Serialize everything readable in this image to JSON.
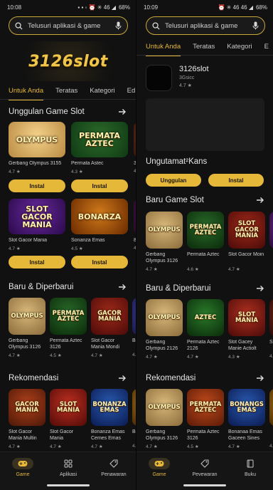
{
  "left": {
    "status": {
      "time": "10:08",
      "battery": "68%",
      "icons": "▪ ▪ ◦  ⏰ ✳ 46 ◢"
    },
    "search": {
      "placeholder": "Telusuri aplikasi & game"
    },
    "banner": {
      "text": "3126slot"
    },
    "tabs": [
      "Untuk Anda",
      "Teratas",
      "Kategori",
      "Ed"
    ],
    "sections": [
      {
        "title": "Unggulan Game Slot"
      },
      {
        "title": "Baru & Diperbarui"
      },
      {
        "title": "Rekomendasi"
      }
    ],
    "featured_row1": [
      {
        "name": "Gerbang Olympus 3155",
        "rating": "4.7 ★",
        "thumb_text": "OLYMPUS",
        "colors": [
          "#f4d28a",
          "#b98a43"
        ]
      },
      {
        "name": "Permata Astec",
        "rating": "4.3 ★",
        "thumb_text": "PERMATA AZTEC",
        "colors": [
          "#2d6a2b",
          "#0f3a14"
        ]
      },
      {
        "name": "3t",
        "rating": "4.",
        "thumb_text": "",
        "colors": [
          "#7a3b1a",
          "#3a1808"
        ]
      }
    ],
    "featured_row1_buttons": [
      "Instal",
      "Instal"
    ],
    "featured_row2": [
      {
        "name": "Slot Gacor Mania",
        "rating": "4.7 ★",
        "thumb_text": "SLOT GACOR MANIA",
        "colors": [
          "#6a2aa0",
          "#2a0a4a"
        ]
      },
      {
        "name": "Sonanza Emas",
        "rating": "4.5 ★",
        "thumb_text": "BONARZA",
        "colors": [
          "#d07a1a",
          "#6a2a00"
        ]
      },
      {
        "name": "8t",
        "rating": "4.",
        "thumb_text": "",
        "colors": [
          "#5a1a5a",
          "#2a082a"
        ]
      }
    ],
    "featured_row2_buttons": [
      "Instal",
      "Instal"
    ],
    "new_row": [
      {
        "name": "Gerbang Olympus 3126",
        "rating": "4.7 ★",
        "thumb_text": "OLYMPUS",
        "colors": [
          "#d9b97a",
          "#8a6a3a"
        ]
      },
      {
        "name": "Permata Aztec 3126",
        "rating": "4.5 ★",
        "thumb_text": "PERMATA AZTEC",
        "colors": [
          "#2a6a2a",
          "#0a2a0a"
        ]
      },
      {
        "name": "Slot Gacor Mania Mondi",
        "rating": "4.7 ★",
        "thumb_text": "GACOR MANIA",
        "colors": [
          "#a02a1a",
          "#4a0a08"
        ]
      },
      {
        "name": "Bo Ma",
        "rating": "4.",
        "thumb_text": "",
        "colors": [
          "#3a3aa0",
          "#1a1a4a"
        ]
      }
    ],
    "rec_row": [
      {
        "name": "Slot Gacor Mania Multin",
        "rating": "4.7 ★",
        "thumb_text": "GACOR MANIA",
        "colors": [
          "#b0401a",
          "#4a1808"
        ]
      },
      {
        "name": "Slot Gacor Mania",
        "rating": "4.7 ★",
        "thumb_text": "SLOT MANIA",
        "colors": [
          "#c03020",
          "#500a08"
        ]
      },
      {
        "name": "Bonanza Emas Cemes Emas",
        "rating": "4.7 ★",
        "thumb_text": "BONANZA EMAS",
        "colors": [
          "#2a5ab0",
          "#0a1a50"
        ]
      },
      {
        "name": "Bo Me",
        "rating": "4.1",
        "thumb_text": "",
        "colors": [
          "#b07a1a",
          "#4a2a00"
        ]
      }
    ],
    "nav": [
      {
        "label": "Game",
        "active": true
      },
      {
        "label": "Aplikasi",
        "active": false
      },
      {
        "label": "Penawaran",
        "active": false
      }
    ]
  },
  "right": {
    "status": {
      "time": "10:09",
      "battery": "68%",
      "icons": "⏰ ✳ 46 46 ◢"
    },
    "search": {
      "placeholder": "Telusuri aplikasi & game"
    },
    "tabs": [
      "Untuk Anda",
      "Teratas",
      "Kategori",
      "E"
    ],
    "app": {
      "name": "3126slot",
      "developer": "3Gsicc",
      "rating": "4.7 ★"
    },
    "sections": [
      {
        "title": "Ungutamat²Kans"
      },
      {
        "title": "Baru Game Slot"
      },
      {
        "title": "Baru & Diperbarui"
      },
      {
        "title": "Rekomendasi"
      }
    ],
    "buttons": [
      "Unggulan",
      "Instal"
    ],
    "slot_row": [
      {
        "name": "Gerbang Olympus 3126",
        "rating": "4.7 ★",
        "thumb_text": "OLYMPUS",
        "colors": [
          "#d9b97a",
          "#8a6a3a"
        ]
      },
      {
        "name": "Permata Aztec",
        "rating": "4.6 ★",
        "thumb_text": "PERMATA AZTEC",
        "colors": [
          "#2a6a2a",
          "#0a2a0a"
        ]
      },
      {
        "name": "Slot Gacor Moin",
        "rating": "4.7 ★",
        "thumb_text": "SLOT GACOR MANIA",
        "colors": [
          "#a02a1a",
          "#4a0a08"
        ]
      },
      {
        "name": "",
        "rating": "",
        "thumb_text": "",
        "colors": [
          "#6a2a8a",
          "#2a0a3a"
        ]
      }
    ],
    "new_row": [
      {
        "name": "Gerbang Olympus 2126",
        "rating": "4.7 ★",
        "thumb_text": "OLYMPUS",
        "colors": [
          "#d9b97a",
          "#8a6a3a"
        ]
      },
      {
        "name": "Permata Aztec 2126",
        "rating": "4.7 ★",
        "thumb_text": "AZTEC",
        "colors": [
          "#2a7a2a",
          "#0a2a0a"
        ]
      },
      {
        "name": "Slot Gacey Manie Actiolt",
        "rating": "4.3 ★",
        "thumb_text": "SLOT MANIA",
        "colors": [
          "#b03020",
          "#4a0a08"
        ]
      },
      {
        "name": "Sl Ge",
        "rating": "4.",
        "thumb_text": "",
        "colors": [
          "#7a2a1a",
          "#2a0a08"
        ]
      }
    ],
    "rec_row": [
      {
        "name": "Gerbang Olympus 3126",
        "rating": "4.7 ★",
        "thumb_text": "OLYMPUS",
        "colors": [
          "#d9b97a",
          "#8a6a3a"
        ]
      },
      {
        "name": "Permata Aztec 3126",
        "rating": "4.5 ★",
        "thumb_text": "PERMATA AZTEC",
        "colors": [
          "#c04a1a",
          "#5a1a08"
        ]
      },
      {
        "name": "Bonanaa Emas Gaceen Sines",
        "rating": "4.7 ★",
        "thumb_text": "BONANGS EMAS",
        "colors": [
          "#2a5ab0",
          "#0a1a50"
        ]
      },
      {
        "name": "",
        "rating": "4.",
        "thumb_text": "",
        "colors": [
          "#b07a1a",
          "#4a2a00"
        ]
      }
    ],
    "nav": [
      {
        "label": "Game",
        "active": true
      },
      {
        "label": "Pevewaran",
        "active": false
      },
      {
        "label": "Buku",
        "active": false
      }
    ]
  },
  "colors": {
    "accent": "#e6b83a",
    "background": "#111111"
  }
}
